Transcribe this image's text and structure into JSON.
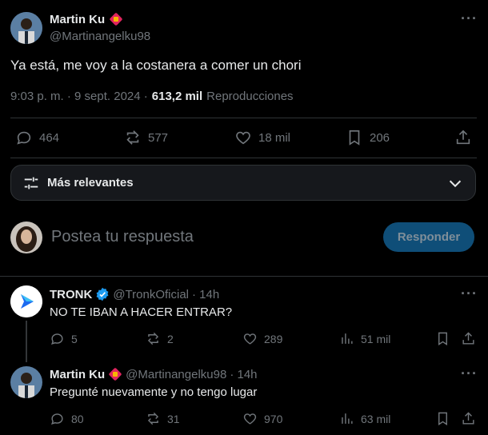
{
  "main_post": {
    "author_name": "Martin Ku",
    "handle": "@Martinangelku98",
    "text": "Ya está, me voy a la costanera a comer un chori",
    "time": "9:03 p. m. · 9 sept. 2024 ·",
    "views": "613,2 mil",
    "views_label": "Reproducciones",
    "stats": {
      "replies": "464",
      "reposts": "577",
      "likes": "18 mil",
      "bookmarks": "206"
    }
  },
  "sort": {
    "label": "Más relevantes"
  },
  "composer": {
    "placeholder": "Postea tu respuesta",
    "button_label": "Responder"
  },
  "replies": [
    {
      "author_name": "TRONK",
      "handle": "@TronkOficial",
      "time": "· 14h",
      "text": "NO TE IBAN A HACER ENTRAR?",
      "stats": {
        "replies": "5",
        "reposts": "2",
        "likes": "289",
        "views": "51 mil"
      }
    },
    {
      "author_name": "Martin Ku",
      "handle": "@Martinangelku98",
      "time": "· 14h",
      "text": "Pregunté nuevamente y no tengo lugar",
      "stats": {
        "replies": "80",
        "reposts": "31",
        "likes": "970",
        "views": "63 mil"
      }
    }
  ],
  "colors": {
    "background": "#000000",
    "text": "#e7e9ea",
    "muted": "#71767b",
    "accent": "#1d9bf0",
    "badge": "#e0245e"
  }
}
